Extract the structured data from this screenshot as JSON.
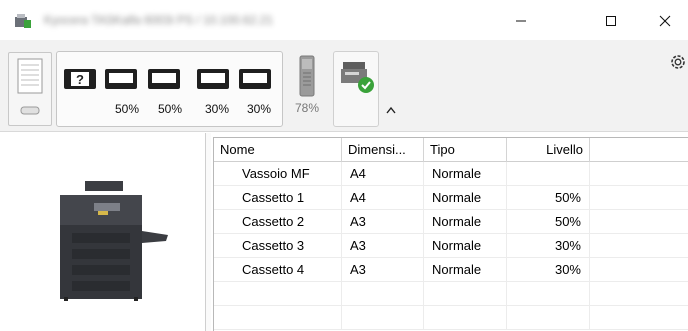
{
  "window": {
    "title": "Kyocera TASKalfa 6003i PS / 10.100.62.21",
    "controls": [
      "minimize",
      "maximize",
      "close"
    ]
  },
  "toolbar": {
    "paper_sources": [
      {
        "name": "Vassoio MF",
        "icon": "unknown-tray-icon",
        "level": ""
      },
      {
        "name": "Cassetto 1",
        "icon": "cassette-icon",
        "level": "50%"
      },
      {
        "name": "Cassetto 2",
        "icon": "cassette-icon",
        "level": "50%"
      },
      {
        "name": "Cassetto 3",
        "icon": "cassette-icon",
        "level": "30%"
      },
      {
        "name": "Cassetto 4",
        "icon": "cassette-icon",
        "level": "30%"
      }
    ],
    "toner_level": "78%",
    "device_status_icon": "printer-ok-icon",
    "collapse_icon": "chevron-up-icon",
    "settings_icon": "gear-icon"
  },
  "table": {
    "columns": [
      "Nome",
      "Dimensi...",
      "Tipo",
      "Livello"
    ],
    "rows": [
      {
        "name": "Vassoio MF",
        "size": "A4",
        "type": "Normale",
        "level": ""
      },
      {
        "name": "Cassetto 1",
        "size": "A4",
        "type": "Normale",
        "level": "50%"
      },
      {
        "name": "Cassetto 2",
        "size": "A3",
        "type": "Normale",
        "level": "50%"
      },
      {
        "name": "Cassetto 3",
        "size": "A3",
        "type": "Normale",
        "level": "30%"
      },
      {
        "name": "Cassetto 4",
        "size": "A3",
        "type": "Normale",
        "level": "30%"
      }
    ]
  },
  "colors": {
    "accent_green": "#3aa23a",
    "toolbar_bg": "#f2f2f2",
    "printer_body": "#3b3d42"
  }
}
